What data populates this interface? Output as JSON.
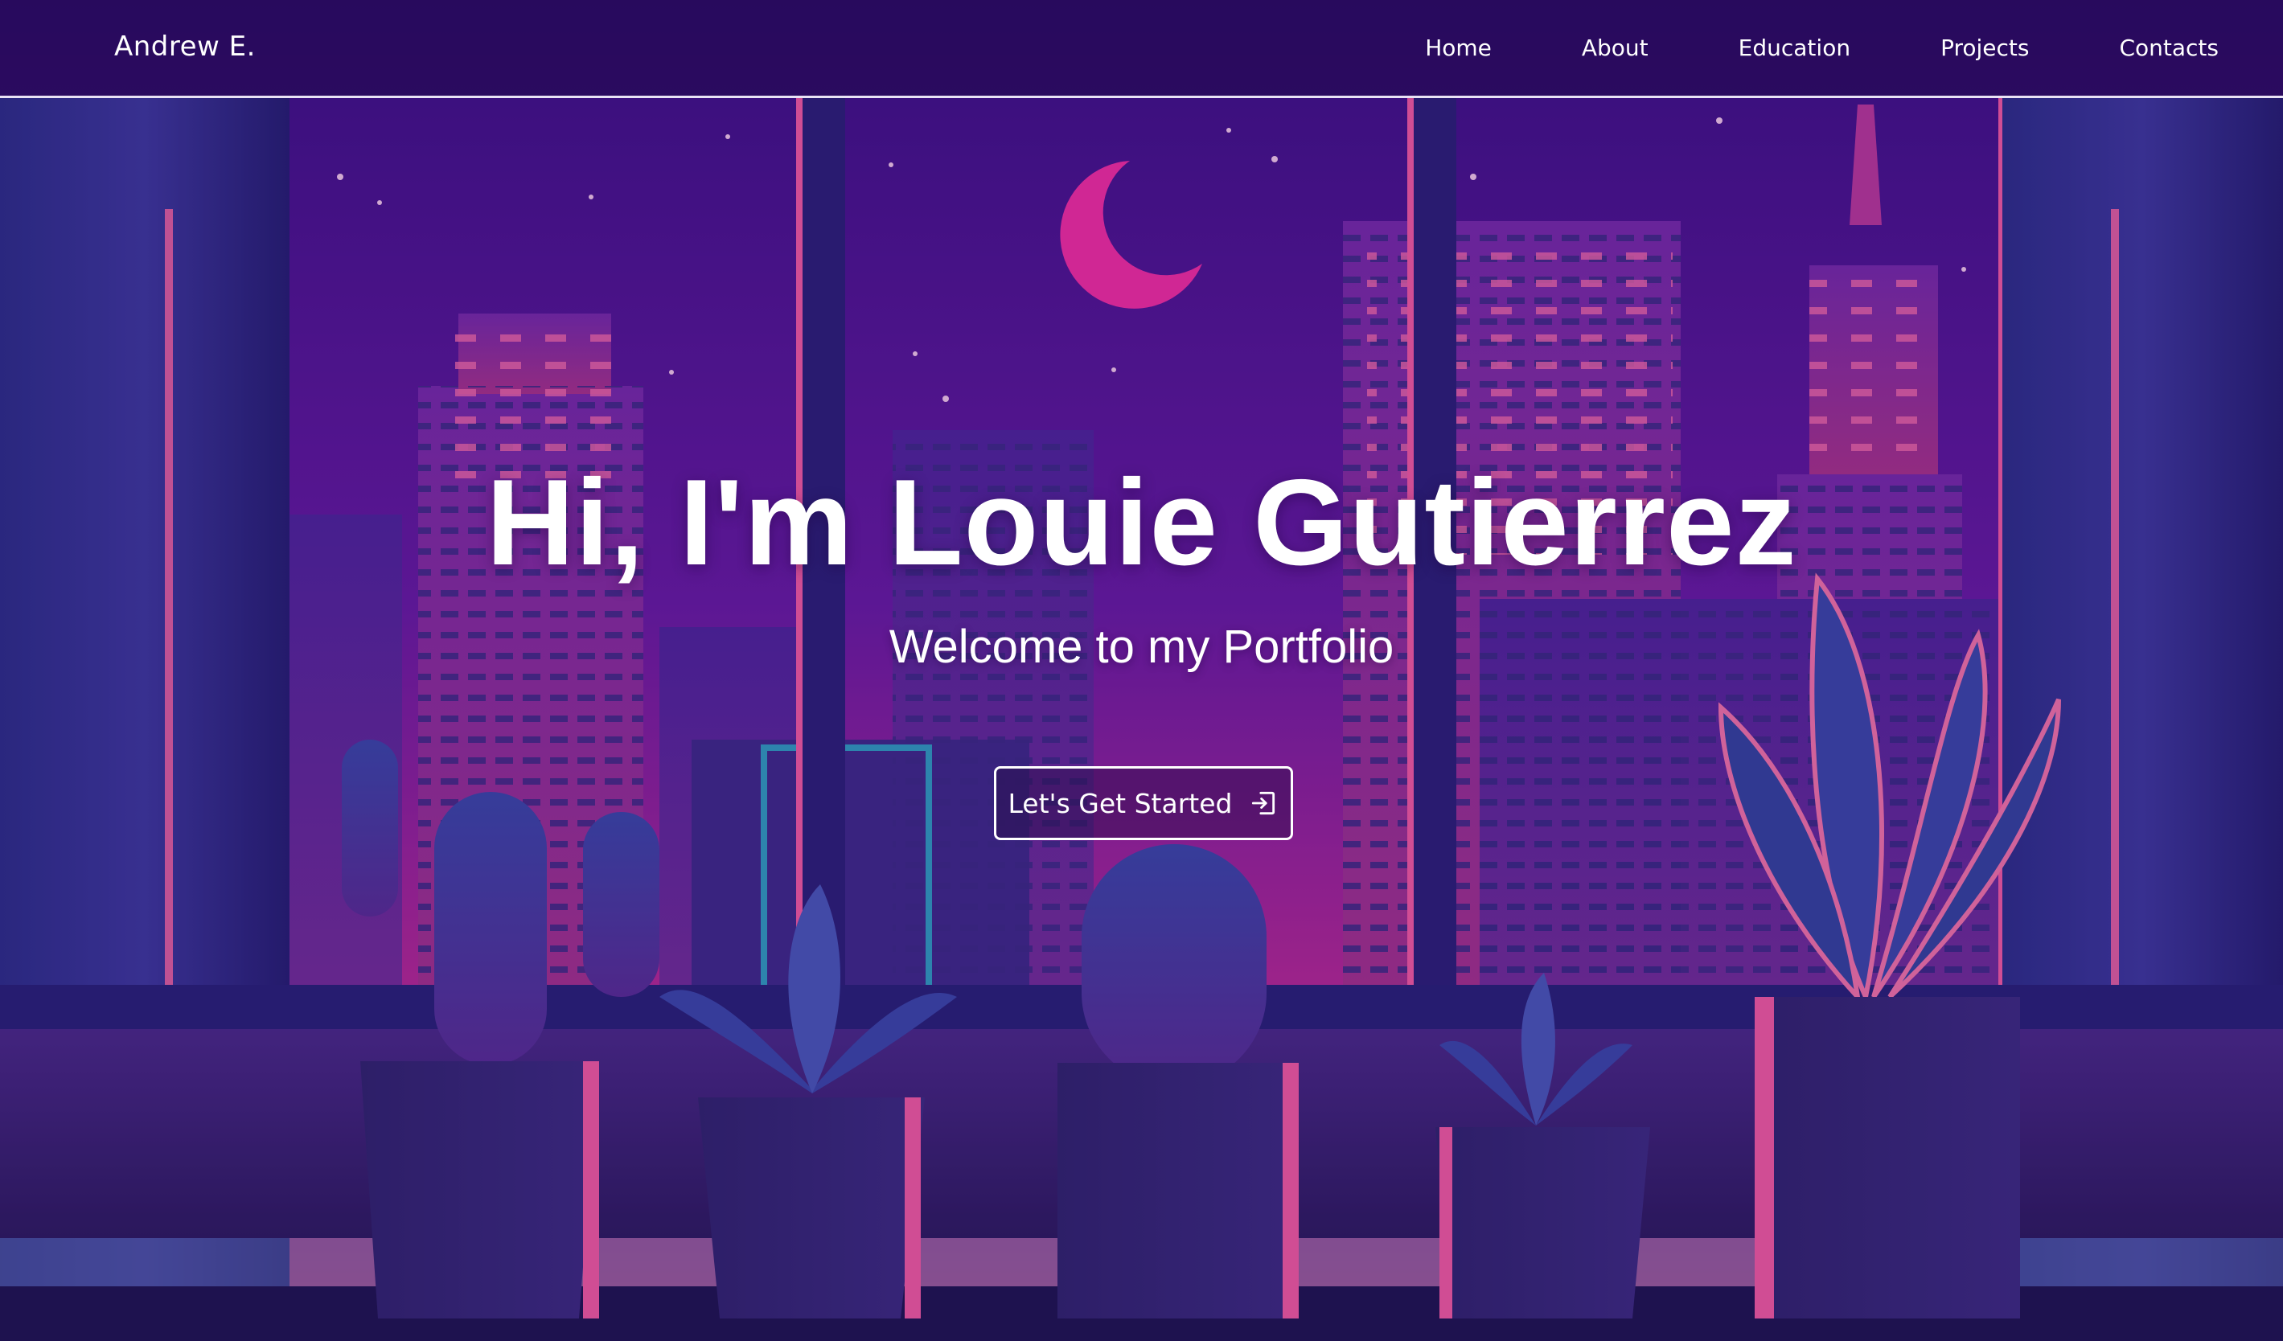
{
  "navbar": {
    "brand": "Andrew E.",
    "links": [
      {
        "label": "Home"
      },
      {
        "label": "About"
      },
      {
        "label": "Education"
      },
      {
        "label": "Projects"
      },
      {
        "label": "Contacts"
      }
    ]
  },
  "hero": {
    "title": "Hi, I'm Louie Gutierrez",
    "subtitle": "Welcome to my Portfolio",
    "cta_label": "Let's Get Started",
    "cta_icon": "sign-in-icon"
  },
  "colors": {
    "sky_top": "#3a0f88",
    "sky_bottom": "#e0389a",
    "moon": "#ff2fa8",
    "curtain": "#2a2b8a",
    "button_border": "#ffffff",
    "text": "#ffffff"
  }
}
